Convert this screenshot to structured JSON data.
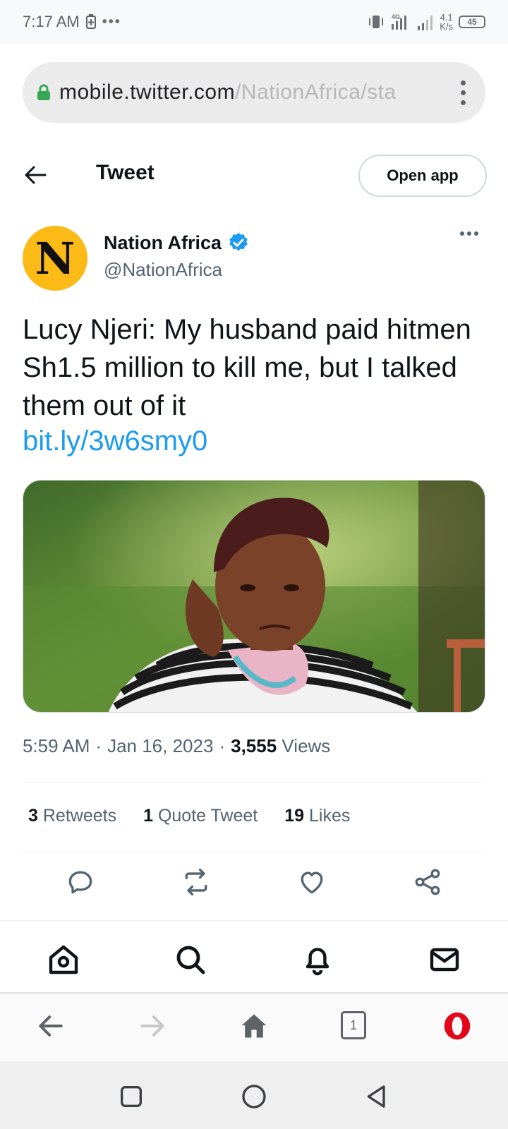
{
  "status_bar": {
    "time": "7:17 AM",
    "network": "4G",
    "speed_value": "4.1",
    "speed_unit": "K/s",
    "battery": "45"
  },
  "url_bar": {
    "domain": "mobile.twitter.com",
    "path": "/NationAfrica/sta"
  },
  "header": {
    "title": "Tweet",
    "open_app_label": "Open app"
  },
  "author": {
    "avatar_letter": "N",
    "name": "Nation Africa",
    "handle": "@NationAfrica",
    "verified": true
  },
  "tweet": {
    "text": "Lucy Njeri: My husband paid hitmen Sh1.5 million to kill me, but I talked them out of it",
    "link": "bit.ly/3w6smy0",
    "time": "5:59 AM",
    "date": "Jan 16, 2023",
    "views_count": "3,555",
    "views_label": "Views",
    "separator": "·"
  },
  "stats": {
    "retweets_count": "3",
    "retweets_label": "Retweets",
    "quotes_count": "1",
    "quotes_label": "Quote Tweet",
    "likes_count": "19",
    "likes_label": "Likes"
  },
  "colors": {
    "link": "#1d9bf0",
    "verified": "#1d9bf0",
    "avatar_bg": "#fbba16",
    "opera_red": "#e3071b"
  },
  "browser_nav": {
    "tab_count": "1"
  }
}
